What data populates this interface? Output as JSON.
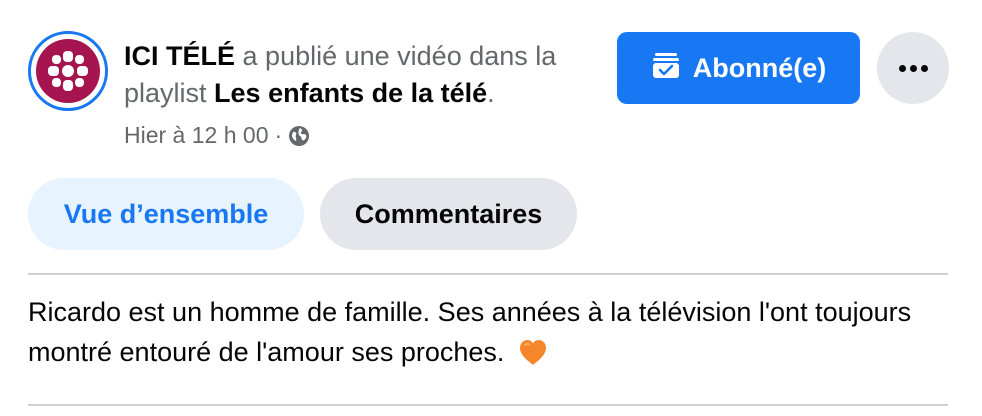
{
  "post": {
    "page_name": "ICI TÉLÉ",
    "action_text": "a publié une vidéo dans la playlist",
    "playlist_name": "Les enfants de la télé",
    "period": ".",
    "timestamp": "Hier à 12 h 00",
    "separator": "·",
    "privacy_icon": "globe-icon",
    "body": "Ricardo est un homme de famille. Ses années à la télévision l'ont toujours montré entouré de l'amour ses proches.",
    "emoji": "orange-heart",
    "avatar_icon": "ici-tele-logo"
  },
  "actions": {
    "subscribe_label": "Abonné(e)",
    "subscribe_icon": "subscribed-check-icon",
    "more_icon": "more-options-icon"
  },
  "tabs": [
    {
      "label": "Vue d’ensemble",
      "active": true
    },
    {
      "label": "Commentaires",
      "active": false
    }
  ],
  "colors": {
    "accent": "#1877f2",
    "avatar": "#a6154f",
    "heart": "#f5862c"
  }
}
